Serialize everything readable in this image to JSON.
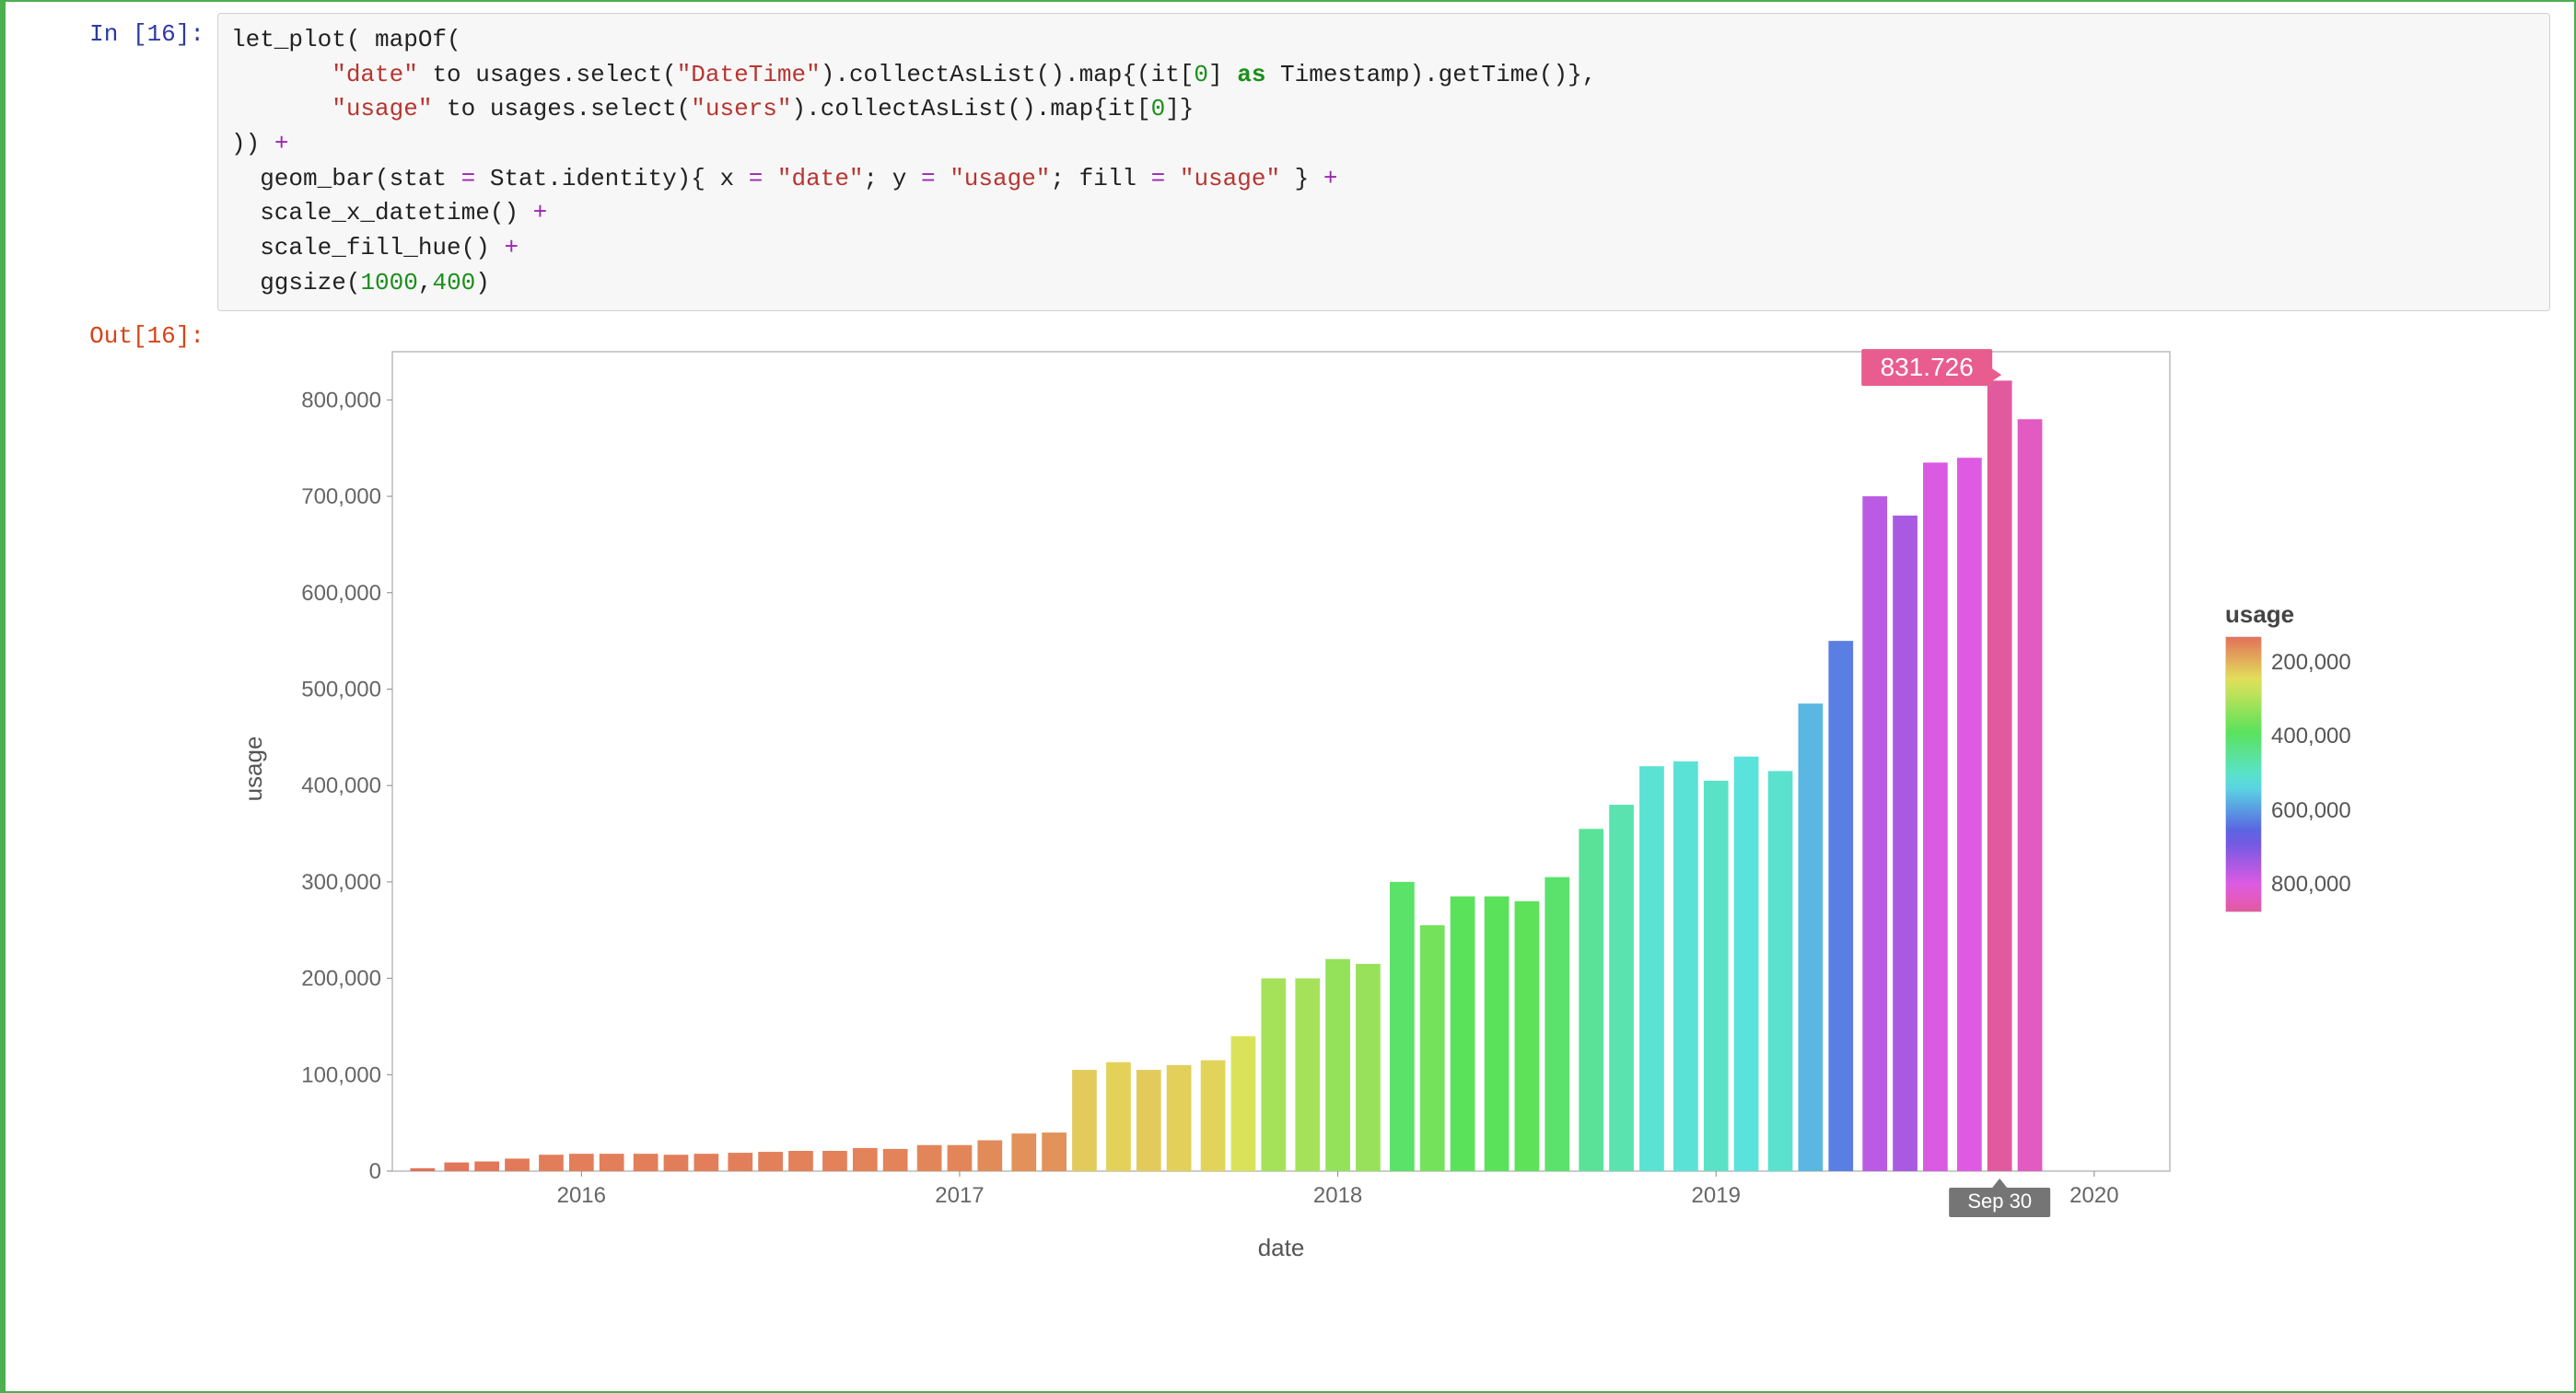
{
  "cell": {
    "in_prompt": "In [16]:",
    "out_prompt": "Out[16]:",
    "code_tokens": [
      {
        "t": "let_plot( mapOf(\n       "
      },
      {
        "t": "\"date\"",
        "c": "tok-str"
      },
      {
        "t": " to usages.select("
      },
      {
        "t": "\"DateTime\"",
        "c": "tok-str"
      },
      {
        "t": ").collectAsList().map{(it["
      },
      {
        "t": "0",
        "c": "tok-num"
      },
      {
        "t": "] "
      },
      {
        "t": "as",
        "c": "tok-kw"
      },
      {
        "t": " Timestamp).getTime()},\n       "
      },
      {
        "t": "\"usage\"",
        "c": "tok-str"
      },
      {
        "t": " to usages.select("
      },
      {
        "t": "\"users\"",
        "c": "tok-str"
      },
      {
        "t": ").collectAsList().map{it["
      },
      {
        "t": "0",
        "c": "tok-num"
      },
      {
        "t": "]}\n"
      },
      {
        "t": ")) "
      },
      {
        "t": "+",
        "c": "tok-op"
      },
      {
        "t": "\n  geom_bar(stat "
      },
      {
        "t": "=",
        "c": "tok-op"
      },
      {
        "t": " Stat.identity){ x "
      },
      {
        "t": "=",
        "c": "tok-op"
      },
      {
        "t": " "
      },
      {
        "t": "\"date\"",
        "c": "tok-str"
      },
      {
        "t": "; y "
      },
      {
        "t": "=",
        "c": "tok-op"
      },
      {
        "t": " "
      },
      {
        "t": "\"usage\"",
        "c": "tok-str"
      },
      {
        "t": "; fill "
      },
      {
        "t": "=",
        "c": "tok-op"
      },
      {
        "t": " "
      },
      {
        "t": "\"usage\"",
        "c": "tok-str"
      },
      {
        "t": " } "
      },
      {
        "t": "+",
        "c": "tok-op"
      },
      {
        "t": "\n  scale_x_datetime() "
      },
      {
        "t": "+",
        "c": "tok-op"
      },
      {
        "t": "\n  scale_fill_hue() "
      },
      {
        "t": "+",
        "c": "tok-op"
      },
      {
        "t": "\n  ggsize("
      },
      {
        "t": "1000",
        "c": "tok-num"
      },
      {
        "t": ","
      },
      {
        "t": "400",
        "c": "tok-num"
      },
      {
        "t": ")"
      }
    ]
  },
  "tooltip": {
    "value_label": "831.726",
    "x_label": "Sep 30"
  },
  "legend": {
    "title": "usage",
    "ticks": [
      "200,000",
      "400,000",
      "600,000",
      "800,000"
    ]
  },
  "chart_data": {
    "type": "bar",
    "xlabel": "date",
    "ylabel": "usage",
    "ylim": [
      0,
      800000
    ],
    "xlim_years": [
      2015.5,
      2020.2
    ],
    "x_tick_years": [
      2016,
      2017,
      2018,
      2019,
      2020
    ],
    "y_ticks": [
      0,
      100000,
      200000,
      300000,
      400000,
      500000,
      600000,
      700000,
      800000
    ],
    "y_tick_labels": [
      "0",
      "100,000",
      "200,000",
      "300,000",
      "400,000",
      "500,000",
      "600,000",
      "700,000",
      "800,000"
    ],
    "fill_scale": "hue",
    "highlight": {
      "x_year": 2019.75,
      "value": 831726,
      "x_tick_text": "Sep 30"
    },
    "series": [
      {
        "name": "usage",
        "x_year": [
          2015.58,
          2015.67,
          2015.75,
          2015.83,
          2015.92,
          2016.0,
          2016.08,
          2016.17,
          2016.25,
          2016.33,
          2016.42,
          2016.5,
          2016.58,
          2016.67,
          2016.75,
          2016.83,
          2016.92,
          2017.0,
          2017.08,
          2017.17,
          2017.25,
          2017.33,
          2017.42,
          2017.5,
          2017.58,
          2017.67,
          2017.75,
          2017.83,
          2017.92,
          2018.0,
          2018.08,
          2018.17,
          2018.25,
          2018.33,
          2018.42,
          2018.5,
          2018.58,
          2018.67,
          2018.75,
          2018.83,
          2018.92,
          2019.0,
          2019.08,
          2019.17,
          2019.25,
          2019.33,
          2019.42,
          2019.5,
          2019.58,
          2019.67,
          2019.75,
          2019.83
        ],
        "values": [
          3000,
          9000,
          10000,
          13000,
          17000,
          18000,
          18000,
          18000,
          17000,
          18000,
          19000,
          20000,
          21000,
          21000,
          24000,
          23000,
          27000,
          27000,
          32000,
          39000,
          40000,
          105000,
          113000,
          105000,
          110000,
          115000,
          140000,
          200000,
          200000,
          220000,
          215000,
          300000,
          255000,
          285000,
          285000,
          280000,
          305000,
          355000,
          380000,
          420000,
          425000,
          405000,
          430000,
          415000,
          485000,
          550000,
          700000,
          680000,
          735000,
          740000,
          820000,
          780000
        ]
      }
    ]
  }
}
